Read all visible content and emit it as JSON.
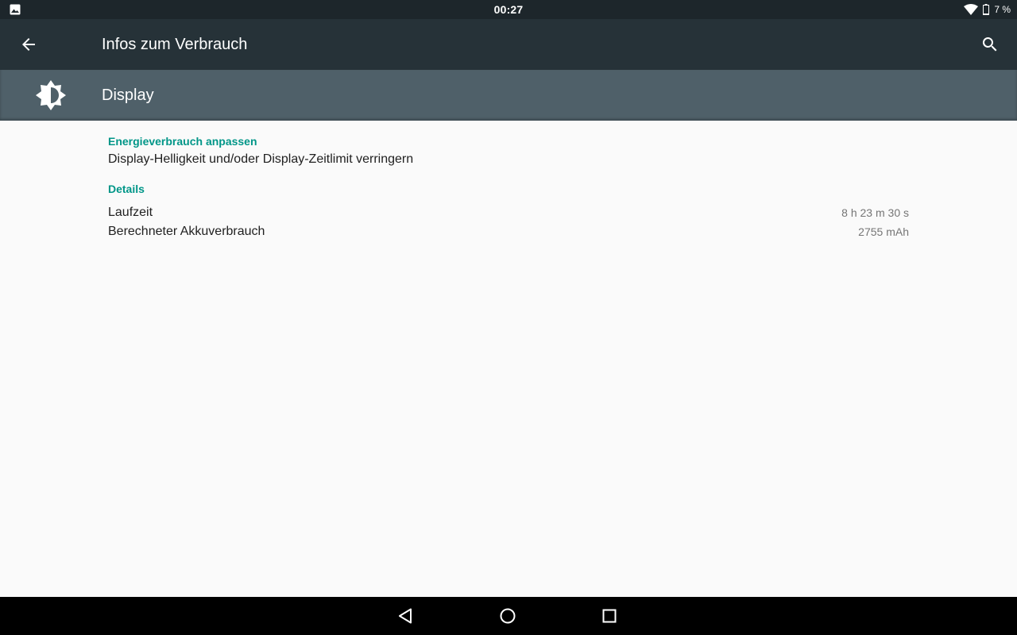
{
  "status_bar": {
    "time": "00:27",
    "battery": "7 %"
  },
  "toolbar": {
    "title": "Infos zum Verbrauch",
    "back_icon": "arrow-left-icon",
    "search_icon": "search-icon"
  },
  "header": {
    "title": "Display",
    "icon": "brightness-icon"
  },
  "sections": {
    "optimize": {
      "title": "Energieverbrauch anpassen",
      "item": "Display-Helligkeit und/oder Display-Zeitlimit verringern"
    },
    "details": {
      "title": "Details",
      "rows": [
        {
          "label": "Laufzeit",
          "value": "8 h 23 m 30 s"
        },
        {
          "label": "Berechneter Akkuverbrauch",
          "value": "2755 mAh"
        }
      ]
    }
  },
  "colors": {
    "toolbar": "#263238",
    "header": "#4f6069",
    "accent": "#009688",
    "background": "#fafafa"
  }
}
